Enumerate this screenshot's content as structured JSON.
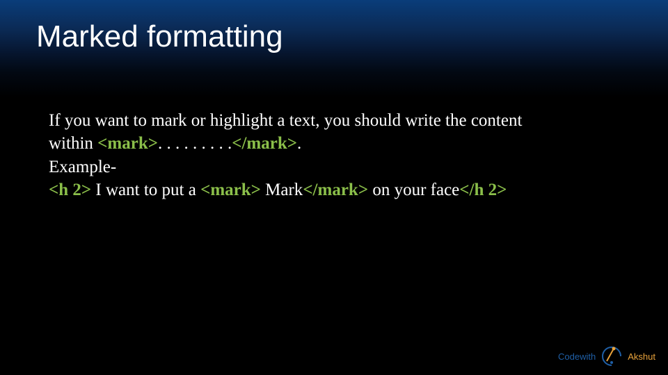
{
  "title": "Marked formatting",
  "body": {
    "line1": "If you want to mark or highlight a text, you should write the content",
    "line2_prefix": "within ",
    "line2_open_tag": "<mark>",
    "line2_dots": ". . . . . . . . .",
    "line2_close_tag": "</mark>",
    "line2_suffix": ".",
    "example_label": "Example-",
    "ex_open_h2": "<h 2>",
    "ex_text1": "  I want to put a ",
    "ex_open_mark": "<mark>",
    "ex_text2": " Mark",
    "ex_close_mark": "</mark>",
    "ex_text3": " on your face",
    "ex_close_h2": "</h 2>"
  },
  "brand": {
    "prefix": "Codewith",
    "name": "Akshut"
  },
  "colors": {
    "tag_green": "#8bbf4a",
    "brand_blue": "#1f5fa6",
    "brand_orange": "#e8a23b"
  }
}
